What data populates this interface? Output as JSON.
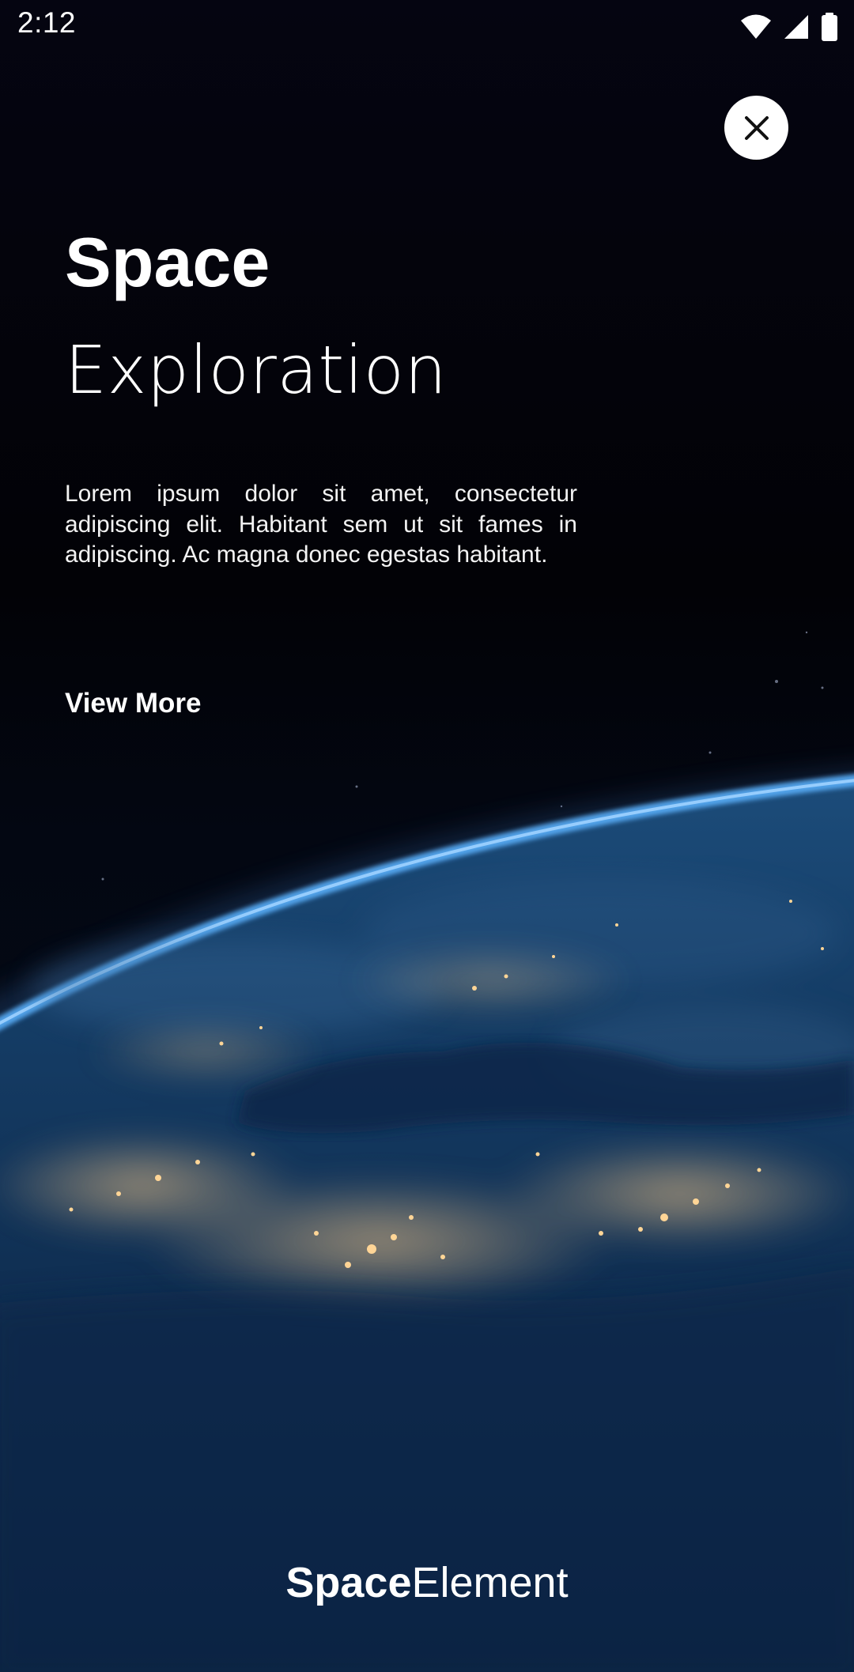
{
  "status_bar": {
    "time": "2:12",
    "icons": [
      "wifi-icon",
      "cell-signal-icon",
      "battery-icon"
    ]
  },
  "close_button": {
    "icon": "close-icon"
  },
  "hero": {
    "title_bold": "Space",
    "title_light": "Exploration",
    "description": "Lorem ipsum dolor sit amet, consectetur adipiscing elit. Habitant sem ut sit fames in adipiscing. Ac magna donec egestas habitant.",
    "cta_label": "View More"
  },
  "brand": {
    "bold": "Space",
    "regular": "Element"
  },
  "colors": {
    "background": "#03030b",
    "text": "#ffffff",
    "atmosphere": "#3d8fe0",
    "ocean": "#0e2a4a",
    "city_lights": "#f2c27a"
  }
}
